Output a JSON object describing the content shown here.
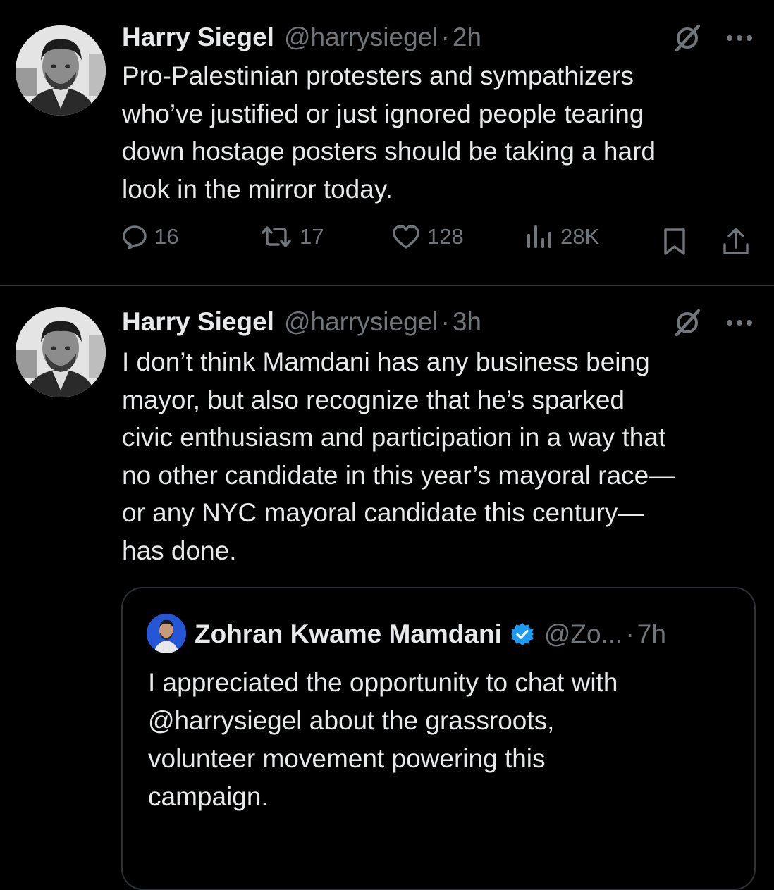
{
  "tweets": [
    {
      "author_name": "Harry Siegel",
      "handle": "@harrysiegel",
      "separator": "·",
      "time": "2h",
      "text": "Pro-Palestinian protesters and sympathizers\nwho’ve justified or just ignored people tearing\ndown hostage posters should be taking a hard\nlook in the mirror today.",
      "stats": {
        "replies": "16",
        "reposts": "17",
        "likes": "128",
        "views": "28K"
      },
      "icons": [
        "grok-icon",
        "more-icon",
        "reply-icon",
        "repost-icon",
        "like-icon",
        "views-icon",
        "bookmark-icon",
        "share-icon"
      ]
    },
    {
      "author_name": "Harry Siegel",
      "handle": "@harrysiegel",
      "separator": "·",
      "time": "3h",
      "text": "I don’t think Mamdani has any business being\nmayor, but also recognize that he’s sparked\ncivic enthusiasm and participation in a way that\nno other candidate in this year’s mayoral race—\nor any NYC mayoral candidate this century—\nhas done.",
      "icons": [
        "grok-icon",
        "more-icon"
      ],
      "quote": {
        "author_name": "Zohran Kwame Mamdani",
        "handle": "@Zo...",
        "separator": "·",
        "time": "7h",
        "verified": true,
        "verified_color": "#1d9bf0",
        "text": "I appreciated the opportunity to chat with\n@harrysiegel about the grassroots,\nvolunteer movement powering this\ncampaign."
      }
    }
  ],
  "colors": {
    "background": "#000000",
    "text": "#e7e9ea",
    "secondary": "#71767b",
    "border": "#2f3336",
    "verified": "#1d9bf0"
  }
}
